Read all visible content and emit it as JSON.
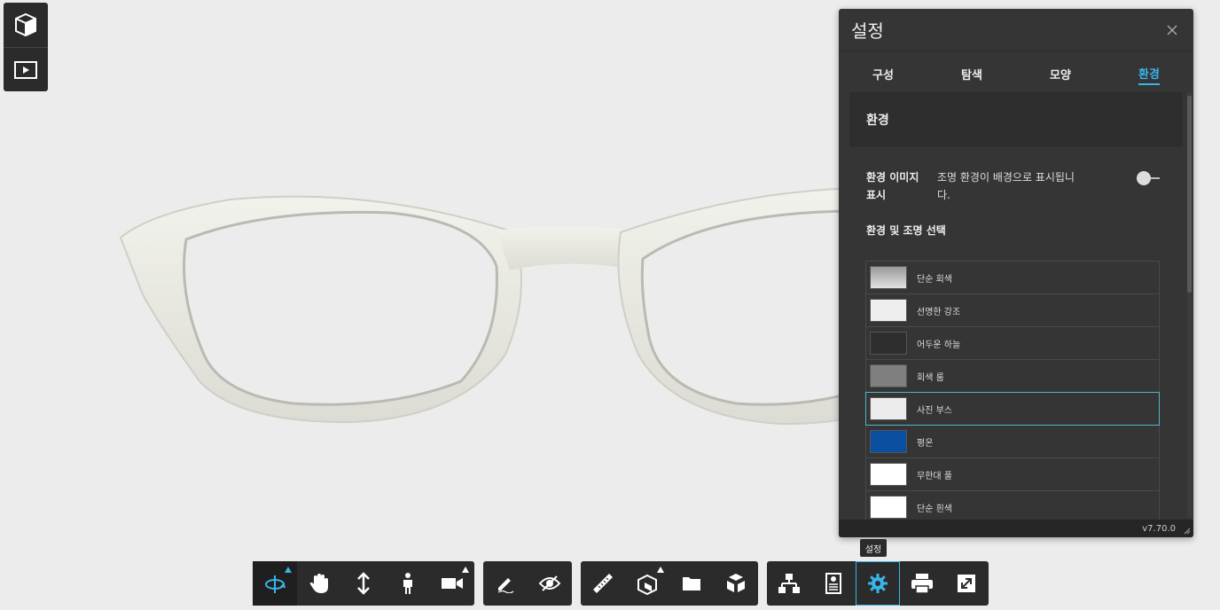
{
  "panel": {
    "title": "설정",
    "tabs": [
      {
        "label": "구성"
      },
      {
        "label": "탐색"
      },
      {
        "label": "모양"
      },
      {
        "label": "환경"
      }
    ],
    "active_tab": "환경",
    "section_title": "환경",
    "env_image": {
      "label": "환경 이미지 표시",
      "description": "조명 환경이 배경으로 표시됩니다.",
      "enabled": false
    },
    "env_select_title": "환경 및 조명 선택",
    "environments": [
      {
        "name": "단순 회색",
        "color": "#bdbdbd"
      },
      {
        "name": "선명한 강조",
        "color": "#eeeeee"
      },
      {
        "name": "어두운 하늘",
        "color": "#2e2e2e"
      },
      {
        "name": "회색 룸",
        "color": "#7f7f7f"
      },
      {
        "name": "사진 부스",
        "color": "#ececec"
      },
      {
        "name": "평온",
        "color": "#0a4fa0"
      },
      {
        "name": "무한대 풀",
        "color": "#ffffff"
      },
      {
        "name": "단순 흰색",
        "color": "#ffffff"
      }
    ],
    "selected_environment": "사진 부스",
    "version": "v7.70.0"
  },
  "tooltip": "설정",
  "colors": {
    "accent": "#38b5e6",
    "background": "#ececec",
    "frame": "#e6e6df",
    "temple": "#c8463f"
  }
}
